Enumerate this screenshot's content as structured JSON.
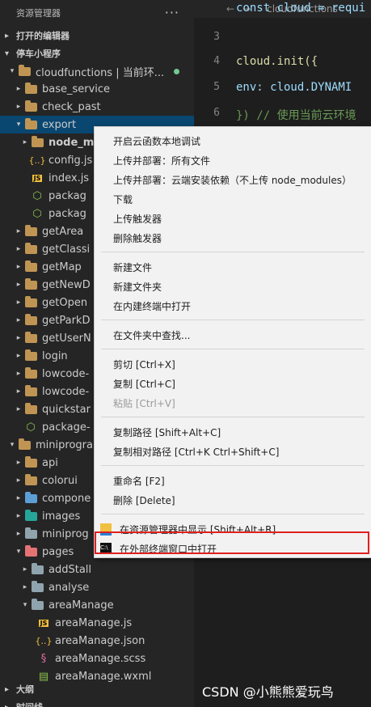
{
  "sidebar": {
    "title": "资源管理器",
    "more": "···",
    "open_editors": "打开的编辑器",
    "project": "停车小程序",
    "tree": [
      {
        "label": "cloudfunctions | 当前环...",
        "icon": "folder-open",
        "indent": 1,
        "open": true,
        "dot": true
      },
      {
        "label": "base_service",
        "icon": "folder",
        "indent": 2
      },
      {
        "label": "check_past",
        "icon": "folder",
        "indent": 2
      },
      {
        "label": "export",
        "icon": "folder-open",
        "indent": 2,
        "open": true,
        "selected": true
      },
      {
        "label": "node_m",
        "icon": "folder",
        "indent": 3,
        "bold": true
      },
      {
        "label": "config.js",
        "icon": "json",
        "indent": 3
      },
      {
        "label": "index.js",
        "icon": "js",
        "indent": 3
      },
      {
        "label": "packag",
        "icon": "npm",
        "indent": 3
      },
      {
        "label": "packag",
        "icon": "npm",
        "indent": 3
      },
      {
        "label": "getArea",
        "icon": "folder",
        "indent": 2
      },
      {
        "label": "getClassi",
        "icon": "folder",
        "indent": 2
      },
      {
        "label": "getMap",
        "icon": "folder",
        "indent": 2
      },
      {
        "label": "getNewD",
        "icon": "folder",
        "indent": 2
      },
      {
        "label": "getOpen",
        "icon": "folder",
        "indent": 2
      },
      {
        "label": "getParkD",
        "icon": "folder",
        "indent": 2
      },
      {
        "label": "getUserN",
        "icon": "folder",
        "indent": 2
      },
      {
        "label": "login",
        "icon": "folder",
        "indent": 2
      },
      {
        "label": "lowcode-",
        "icon": "folder",
        "indent": 2
      },
      {
        "label": "lowcode-",
        "icon": "folder",
        "indent": 2
      },
      {
        "label": "quickstar",
        "icon": "folder",
        "indent": 2
      },
      {
        "label": "package-",
        "icon": "npm",
        "indent": 2
      },
      {
        "label": "miniprogra",
        "icon": "folder-open",
        "indent": 1,
        "open": true
      },
      {
        "label": "api",
        "icon": "folder",
        "indent": 2
      },
      {
        "label": "colorui",
        "icon": "folder",
        "indent": 2
      },
      {
        "label": "compone",
        "icon": "folder-blue",
        "indent": 2
      },
      {
        "label": "images",
        "icon": "folder-teal",
        "indent": 2
      },
      {
        "label": "miniprog",
        "icon": "folder-gray",
        "indent": 2
      },
      {
        "label": "pages",
        "icon": "folder-red",
        "indent": 2,
        "open": true
      },
      {
        "label": "addStall",
        "icon": "folder-gray",
        "indent": 3
      },
      {
        "label": "analyse",
        "icon": "folder-gray",
        "indent": 3
      },
      {
        "label": "areaManage",
        "icon": "folder-gray",
        "indent": 3,
        "open": true
      },
      {
        "label": "areaManage.js",
        "icon": "js",
        "indent": 4
      },
      {
        "label": "areaManage.json",
        "icon": "json",
        "indent": 4
      },
      {
        "label": "areaManage.scss",
        "icon": "scss",
        "indent": 4
      },
      {
        "label": "areaManage.wxml",
        "icon": "wxml",
        "indent": 4
      }
    ],
    "outline": "大纲",
    "timeline": "时间线"
  },
  "editor": {
    "tab": "cloudfunctions",
    "lines": [
      {
        "n": "",
        "code": "const cloud = requi",
        "cls": "id"
      },
      {
        "n": "3",
        "code": "",
        "cls": "op"
      },
      {
        "n": "4",
        "code": "cloud.init({",
        "cls": "kw"
      },
      {
        "n": "5",
        "code": "  env: cloud.DYNAMI",
        "cls": "id"
      },
      {
        "n": "6",
        "code": "}) // 使用当前云环境",
        "cls": "cm"
      }
    ]
  },
  "context_menu": {
    "groups": [
      [
        {
          "label": "开启云函数本地调试"
        },
        {
          "label": "上传并部署：所有文件"
        },
        {
          "label": "上传并部署：云端安装依赖（不上传 node_modules）"
        },
        {
          "label": "下载"
        },
        {
          "label": "上传触发器"
        },
        {
          "label": "删除触发器"
        }
      ],
      [
        {
          "label": "新建文件"
        },
        {
          "label": "新建文件夹"
        },
        {
          "label": "在内建终端中打开"
        }
      ],
      [
        {
          "label": "在文件夹中查找..."
        }
      ],
      [
        {
          "label": "剪切  [Ctrl+X]"
        },
        {
          "label": "复制  [Ctrl+C]"
        },
        {
          "label": "粘贴  [Ctrl+V]",
          "disabled": true
        }
      ],
      [
        {
          "label": "复制路径  [Shift+Alt+C]"
        },
        {
          "label": "复制相对路径  [Ctrl+K Ctrl+Shift+C]"
        }
      ],
      [
        {
          "label": "重命名  [F2]"
        },
        {
          "label": "删除  [Delete]"
        }
      ],
      [
        {
          "label": "在资源管理器中显示  [Shift+Alt+R]",
          "icon": "explorer-icon"
        },
        {
          "label": "在外部终端窗口中打开",
          "icon": "terminal-icon"
        }
      ]
    ]
  },
  "watermark": "CSDN @小熊熊爱玩鸟"
}
